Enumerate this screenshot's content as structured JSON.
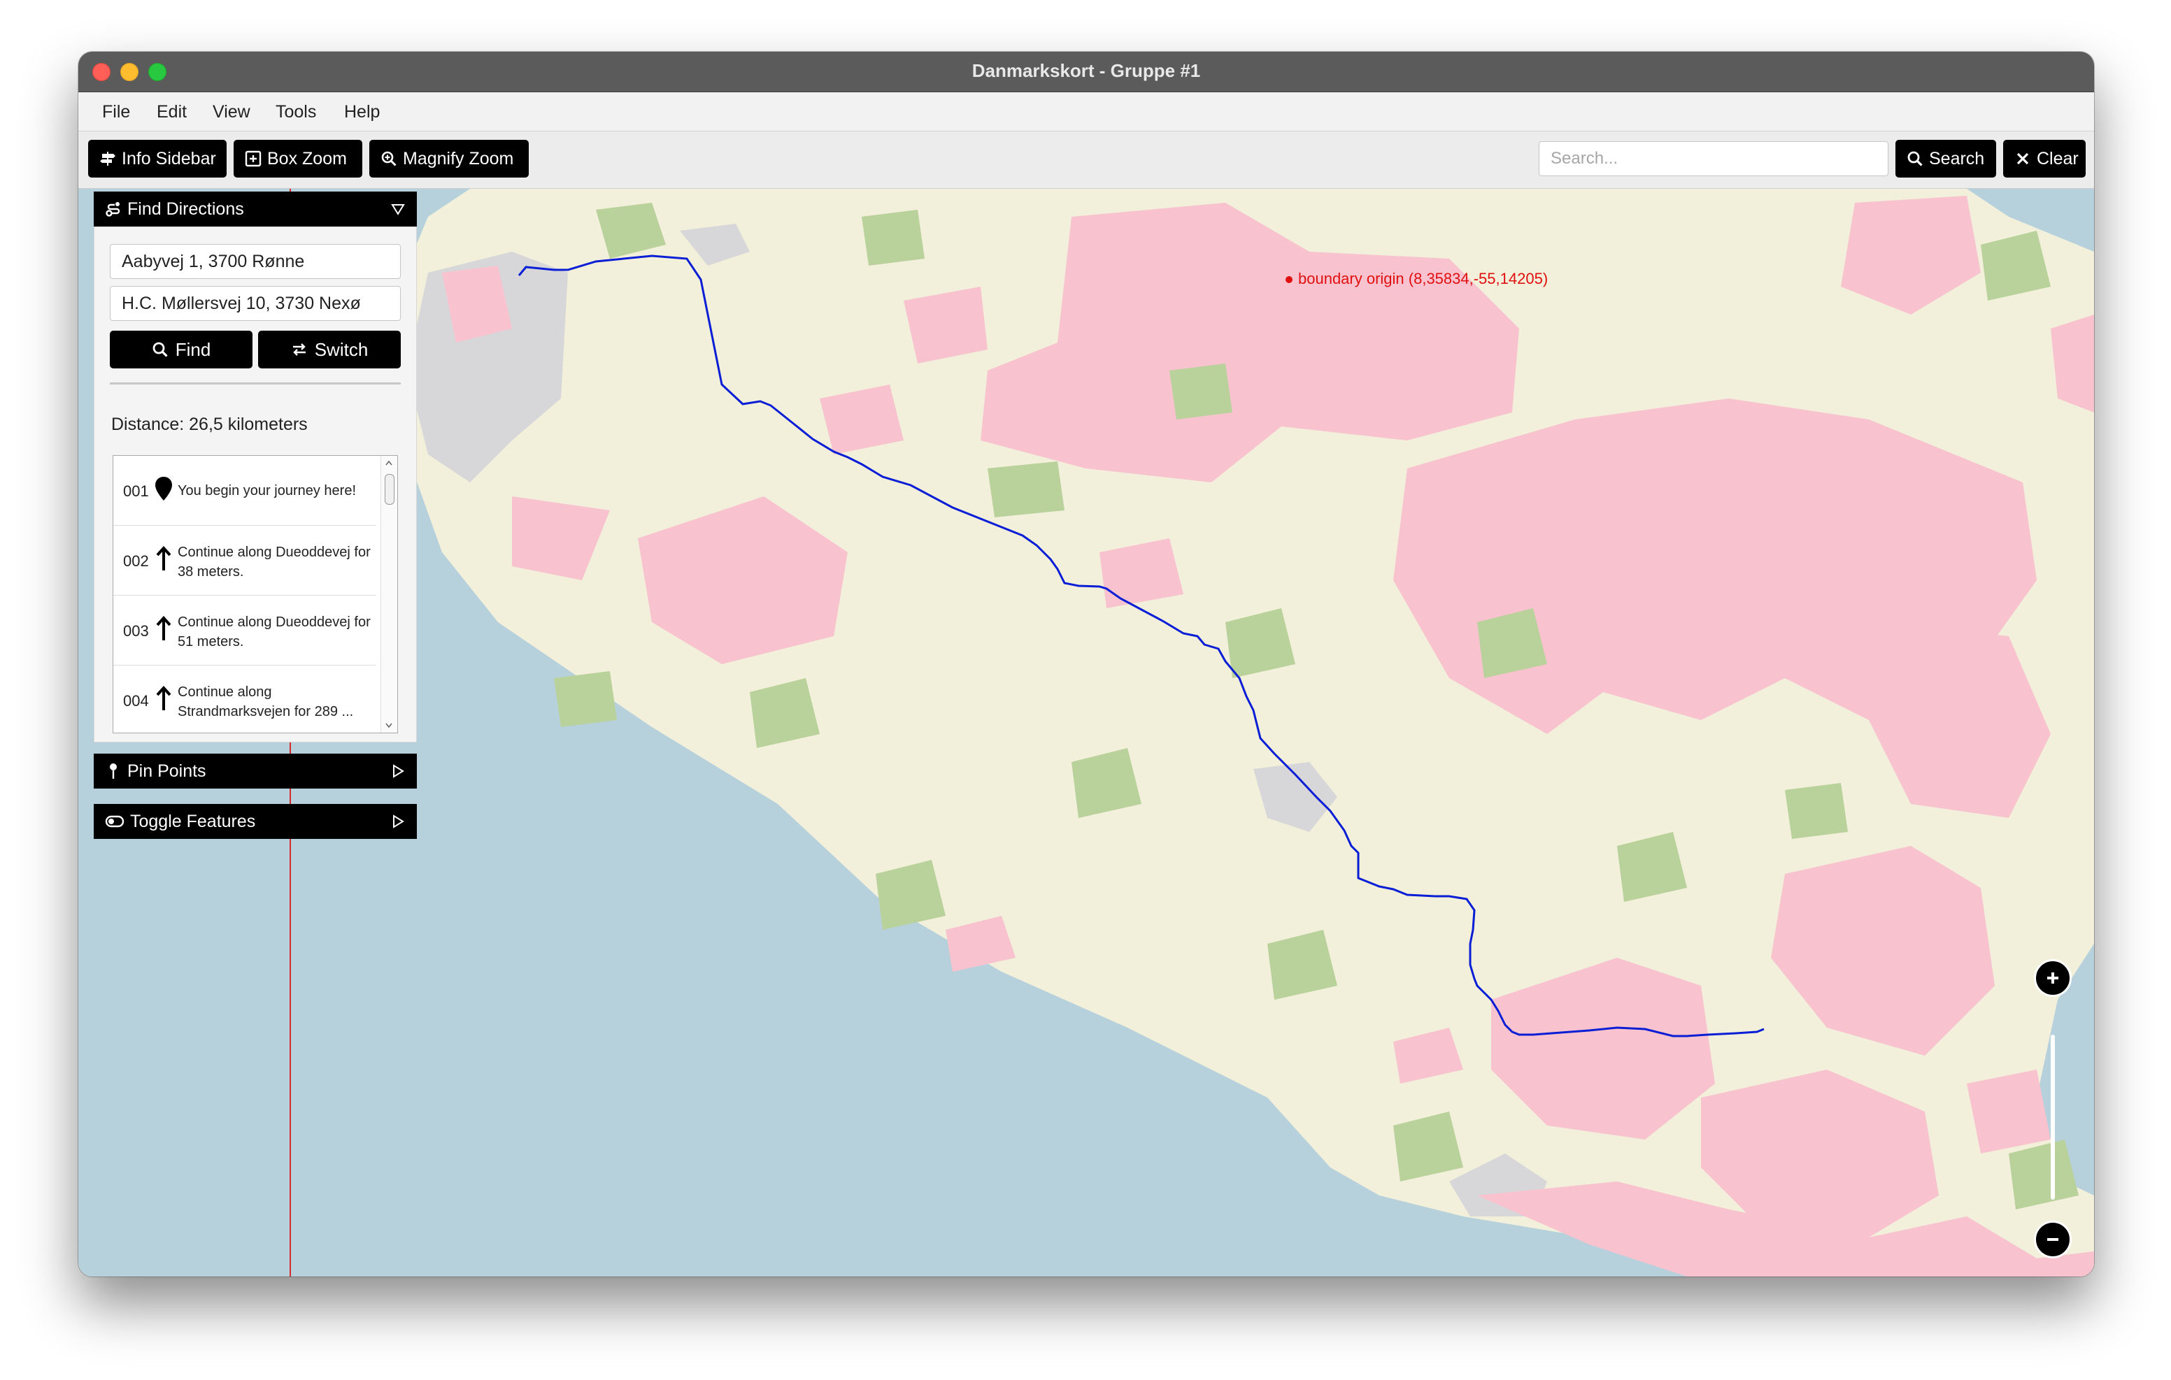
{
  "window": {
    "title": "Danmarkskort - Gruppe #1"
  },
  "menu": {
    "items": [
      "File",
      "Edit",
      "View",
      "Tools",
      "Help"
    ]
  },
  "toolbar": {
    "info_sidebar": "Info Sidebar",
    "box_zoom": "Box Zoom",
    "magnify_zoom": "Magnify Zoom",
    "search_placeholder": "Search...",
    "search_label": "Search",
    "clear_label": "Clear"
  },
  "sidebar": {
    "find_directions": {
      "title": "Find Directions",
      "from_value": "Aabyvej 1, 3700 Rønne",
      "to_value": "H.C. Møllersvej 10, 3730 Nexø",
      "find_label": "Find",
      "switch_label": "Switch",
      "distance": "Distance: 26,5 kilometers",
      "steps": [
        {
          "num": "001",
          "icon": "map-pin-icon",
          "text": "You begin your journey here!"
        },
        {
          "num": "002",
          "icon": "arrow-up-icon",
          "text": "Continue along Dueoddevej for 38 meters."
        },
        {
          "num": "003",
          "icon": "arrow-up-icon",
          "text": "Continue along Dueoddevej for 51 meters."
        },
        {
          "num": "004",
          "icon": "arrow-up-icon",
          "text": "Continue along Strandmarksvejen for 289 ..."
        }
      ]
    },
    "pin_points": {
      "title": "Pin Points"
    },
    "toggle_features": {
      "title": "Toggle Features"
    }
  },
  "map": {
    "boundary_label": "boundary origin (8,35834,-55,14205)",
    "colors": {
      "land": "#f2efda",
      "sea": "#b6d1dc",
      "residential": "#f8c3cf",
      "forest": "#b9d19a",
      "urban": "#d7d7da",
      "route": "#0a1ed6",
      "boundary_line": "#d42c2c"
    }
  }
}
